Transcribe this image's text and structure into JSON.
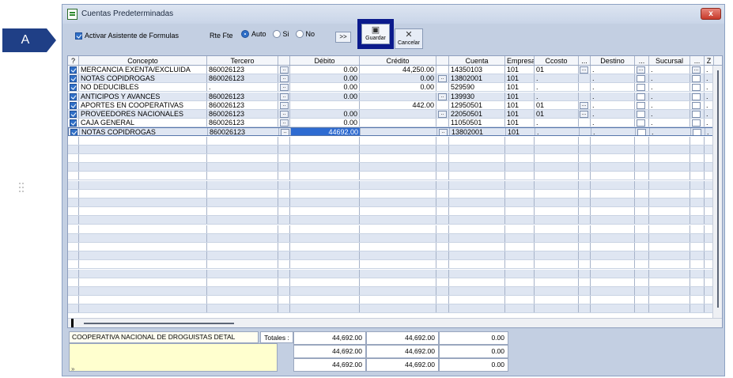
{
  "callout": {
    "label": "A"
  },
  "window": {
    "title": "Cuentas Predeterminadas",
    "close_label": "x"
  },
  "toolbar": {
    "asistente_label": "Activar Asistente de Formulas",
    "rte_label": "Rte Fte",
    "radio_options": [
      {
        "label": "Auto",
        "selected": true
      },
      {
        "label": "Si",
        "selected": false
      },
      {
        "label": "No",
        "selected": false
      }
    ],
    "more_label": ">>",
    "guardar_label": "Guardar",
    "cancelar_label": "Cancelar"
  },
  "grid": {
    "headers": [
      "?",
      "Concepto",
      "Tercero",
      "",
      "Débito",
      "Crédito",
      "",
      "Cuenta",
      "Empresa",
      "Ccosto",
      "...",
      "Destino",
      "...",
      "Sucursal",
      "...",
      "Z"
    ],
    "rows": [
      {
        "concepto": "MERCANCIA EXENTA/EXCLUIDA",
        "tercero": "860026123",
        "debito": "0.00",
        "credito": "44,250.00",
        "cuenta": "14350103",
        "empresa": "101",
        "ccosto": "01",
        "destino": ".",
        "sucursal": ".",
        "z": "."
      },
      {
        "concepto": "NOTAS COPIDROGAS",
        "tercero": "860026123",
        "debito": "0.00",
        "credito": "0.00",
        "cuenta": "13802001",
        "empresa": "101",
        "ccosto": ".",
        "destino": ".",
        "sucursal": ".",
        "z": "."
      },
      {
        "concepto": "NO DEDUCIBLES",
        "tercero": ".",
        "debito": "0.00",
        "credito": "0.00",
        "cuenta": "529590",
        "empresa": "101",
        "ccosto": ".",
        "destino": ".",
        "sucursal": ".",
        "z": "."
      },
      {
        "concepto": "ANTICIPOS Y AVANCES",
        "tercero": "860026123",
        "debito": "0.00",
        "credito": "",
        "cuenta": "139930",
        "empresa": "101",
        "ccosto": ".",
        "destino": ".",
        "sucursal": ".",
        "z": "."
      },
      {
        "concepto": "APORTES EN COOPERATIVAS",
        "tercero": "860026123",
        "debito": "",
        "credito": "442.00",
        "cuenta": "12950501",
        "empresa": "101",
        "ccosto": "01",
        "destino": ".",
        "sucursal": ".",
        "z": "."
      },
      {
        "concepto": "PROVEEDORES NACIONALES",
        "tercero": "860026123",
        "debito": "0.00",
        "credito": "",
        "cuenta": "22050501",
        "empresa": "101",
        "ccosto": "01",
        "destino": ".",
        "sucursal": ".",
        "z": "."
      },
      {
        "concepto": "CAJA GENERAL",
        "tercero": "860026123",
        "debito": "0.00",
        "credito": "",
        "cuenta": "11050501",
        "empresa": "101",
        "ccosto": ".",
        "destino": ".",
        "sucursal": ".",
        "z": "."
      },
      {
        "concepto": "NOTAS COPIDROGAS",
        "tercero": "860026123",
        "debito": "44692.00",
        "credito": "",
        "cuenta": "13802001",
        "empresa": "101",
        "ccosto": ".",
        "destino": ".",
        "sucursal": ".",
        "z": "."
      }
    ]
  },
  "footer": {
    "empresa_name": "COOPERATIVA NACIONAL DE DROGUISTAS DETAL",
    "totales_label": "Totales :",
    "totals": [
      [
        "44,692.00",
        "44,692.00",
        "0.00"
      ],
      [
        "44,692.00",
        "44,692.00",
        "0.00"
      ],
      [
        "44,692.00",
        "44,692.00",
        "0.00"
      ]
    ]
  },
  "colors": {
    "accent": "#2e6bd1",
    "callout": "#1f3f86",
    "highlight_border": "#0b1a8c"
  }
}
